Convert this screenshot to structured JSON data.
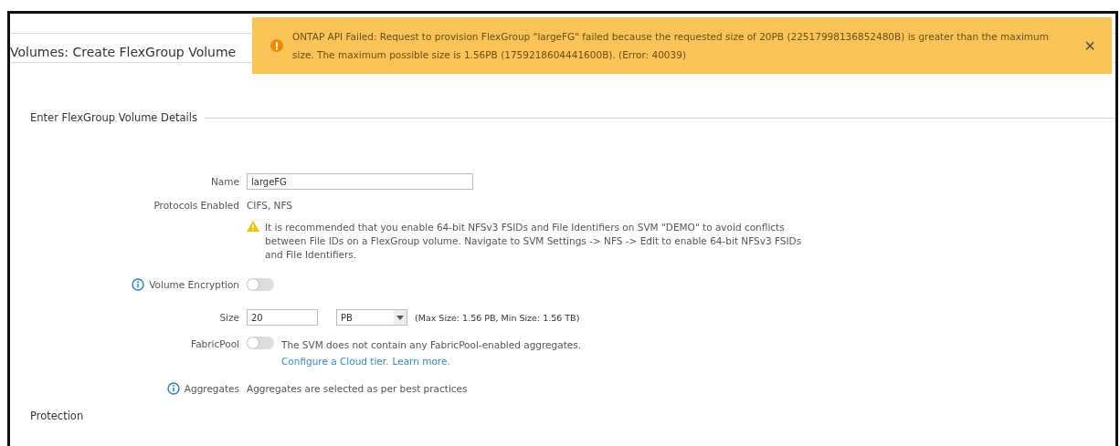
{
  "page_title": "Volumes: Create FlexGroup Volume",
  "alert": {
    "message": "ONTAP API Failed: Request to provision FlexGroup \"largeFG\" failed because the requested size of 20PB (22517998136852480B) is greater than the maximum size. The maximum possible size is 1.56PB (1759218604441600B). (Error: 40039)",
    "close": "×"
  },
  "section": {
    "legend": "Enter FlexGroup Volume Details",
    "name": {
      "label": "Name",
      "value": "largeFG"
    },
    "protocols": {
      "label": "Protocols Enabled",
      "value": "CIFS, NFS"
    },
    "warning": "It is recommended that you enable 64-bit NFSv3 FSIDs and File Identifiers on SVM \"DEMO\" to avoid conflicts between File IDs on a FlexGroup volume. Navigate to SVM Settings -> NFS -> Edit to enable 64-bit NFSv3 FSIDs and File Identifiers.",
    "encryption": {
      "label": "Volume Encryption",
      "on": false
    },
    "size": {
      "label": "Size",
      "value": "20",
      "unit": "PB",
      "hint": "(Max Size: 1.56 PB, Min Size: 1.56 TB)"
    },
    "fabricpool": {
      "label": "FabricPool",
      "on": false,
      "message": "The SVM does not contain any FabricPool-enabled aggregates.",
      "links": [
        "Configure a Cloud tier.",
        "Learn more."
      ]
    },
    "aggregates": {
      "label": "Aggregates",
      "value": "Aggregates are selected as per best practices"
    }
  },
  "next_section": "Protection"
}
